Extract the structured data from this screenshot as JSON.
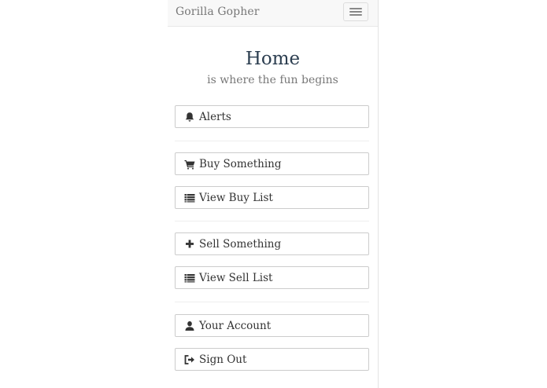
{
  "navbar": {
    "brand": "Gorilla Gopher",
    "toggle_icon": "hamburger-menu-icon"
  },
  "header": {
    "title": "Home",
    "subtitle": "is where the fun begins"
  },
  "menu": {
    "alerts": {
      "label": "Alerts",
      "icon": "bell-icon"
    },
    "buy_something": {
      "label": "Buy Something",
      "icon": "shopping-cart-icon"
    },
    "view_buy_list": {
      "label": "View Buy List",
      "icon": "list-icon"
    },
    "sell_something": {
      "label": "Sell Something",
      "icon": "plus-icon"
    },
    "view_sell_list": {
      "label": "View Sell List",
      "icon": "list-icon"
    },
    "your_account": {
      "label": "Your Account",
      "icon": "user-icon"
    },
    "sign_out": {
      "label": "Sign Out",
      "icon": "sign-out-icon"
    }
  },
  "colors": {
    "title": "#2c3e50",
    "muted": "#777777",
    "text": "#333333",
    "navbar_bg": "#f8f8f8",
    "border": "#cccccc"
  }
}
